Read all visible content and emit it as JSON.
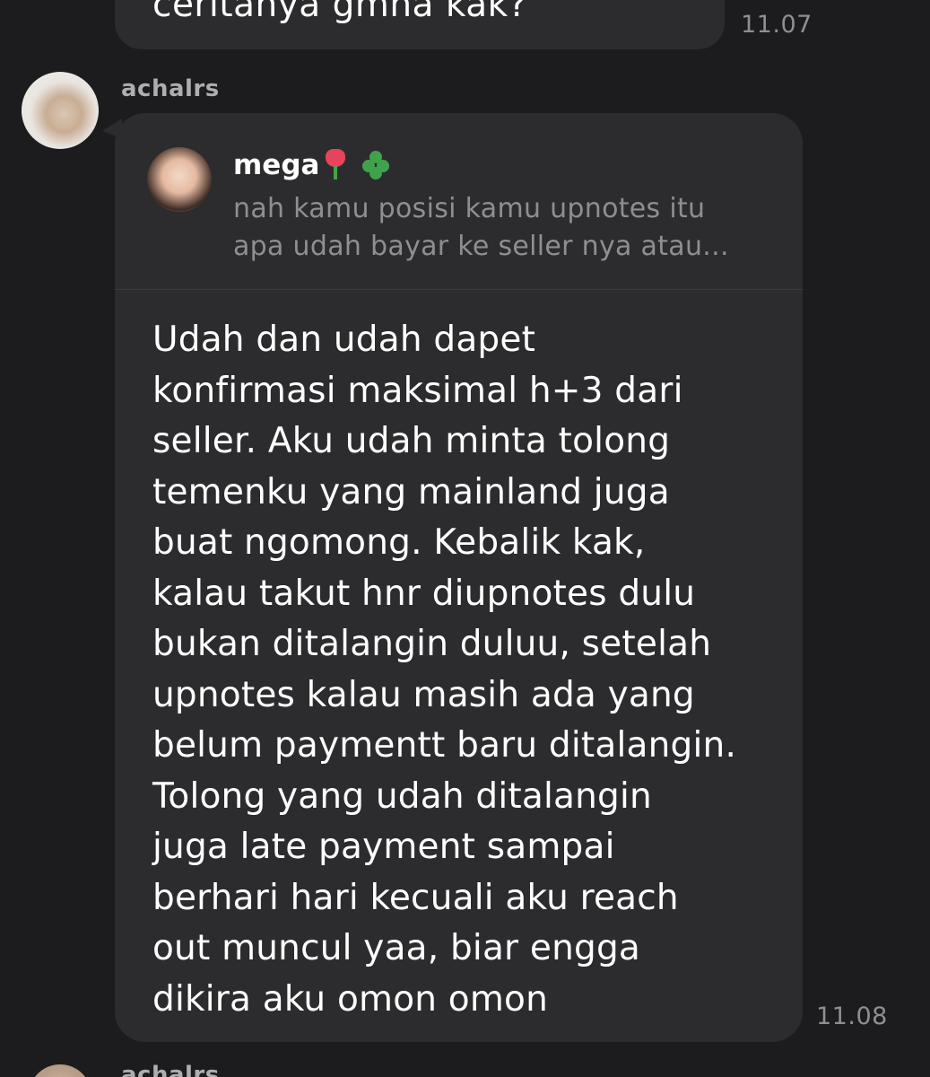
{
  "previous_message": {
    "text": "ceritanya gmna kak?",
    "time": "11.07"
  },
  "message": {
    "sender": "achalrs",
    "reply": {
      "name": "mega",
      "preview_lines": [
        "nah kamu posisi kamu upnotes itu",
        "apa udah bayar ke seller nya atau..."
      ]
    },
    "lines": [
      "Udah dan udah dapet",
      "konfirmasi maksimal h+3 dari",
      "seller. Aku udah minta tolong",
      "temenku yang mainland juga",
      "buat ngomong. Kebalik kak,",
      "kalau takut hnr diupnotes dulu",
      "bukan ditalangin duluu, setelah",
      "upnotes kalau masih ada yang",
      "belum paymentt baru ditalangin.",
      "Tolong yang udah ditalangin",
      "juga late payment sampai",
      "berhari hari kecuali aku reach",
      "out muncul yaa, biar engga",
      "dikira aku omon omon"
    ],
    "time": "11.08"
  },
  "next_message": {
    "sender": "achalrs"
  },
  "colors": {
    "background": "#1c1c1e",
    "bubble": "#2c2c2e",
    "text": "#ffffff",
    "muted": "#8e8e93"
  }
}
